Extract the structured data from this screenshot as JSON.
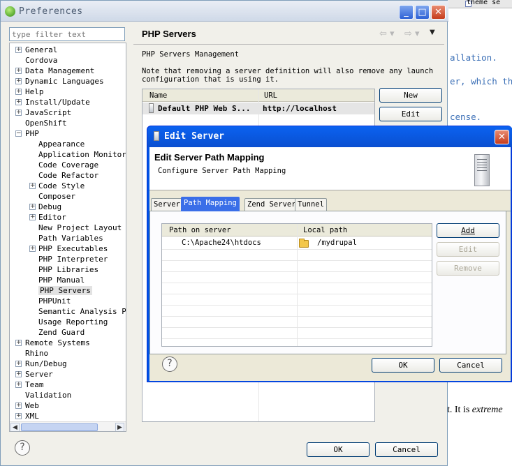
{
  "background_editor": {
    "tab_label": "theme se",
    "line1": "allation.",
    "line2": "er, which th",
    "line3": "cense.",
    "line4_prefix": "t. It is ",
    "line4_em": "extreme"
  },
  "preferences": {
    "title": "Preferences",
    "filter_placeholder": "type filter text",
    "tree": [
      {
        "label": "General",
        "expandable": true,
        "depth": 0
      },
      {
        "label": "Cordova",
        "expandable": false,
        "depth": 0
      },
      {
        "label": "Data Management",
        "expandable": true,
        "depth": 0
      },
      {
        "label": "Dynamic Languages",
        "expandable": true,
        "depth": 0
      },
      {
        "label": "Help",
        "expandable": true,
        "depth": 0
      },
      {
        "label": "Install/Update",
        "expandable": true,
        "depth": 0
      },
      {
        "label": "JavaScript",
        "expandable": true,
        "depth": 0
      },
      {
        "label": "OpenShift",
        "expandable": false,
        "depth": 0
      },
      {
        "label": "PHP",
        "expandable": true,
        "expanded": true,
        "depth": 0
      },
      {
        "label": "Appearance",
        "expandable": false,
        "depth": 1
      },
      {
        "label": "Application Monitorin",
        "expandable": false,
        "depth": 1
      },
      {
        "label": "Code Coverage",
        "expandable": false,
        "depth": 1
      },
      {
        "label": "Code Refactor",
        "expandable": false,
        "depth": 1
      },
      {
        "label": "Code Style",
        "expandable": true,
        "depth": 1
      },
      {
        "label": "Composer",
        "expandable": false,
        "depth": 1
      },
      {
        "label": "Debug",
        "expandable": true,
        "depth": 1
      },
      {
        "label": "Editor",
        "expandable": true,
        "depth": 1
      },
      {
        "label": "New Project Layout",
        "expandable": false,
        "depth": 1
      },
      {
        "label": "Path Variables",
        "expandable": false,
        "depth": 1
      },
      {
        "label": "PHP Executables",
        "expandable": true,
        "depth": 1
      },
      {
        "label": "PHP Interpreter",
        "expandable": false,
        "depth": 1
      },
      {
        "label": "PHP Libraries",
        "expandable": false,
        "depth": 1
      },
      {
        "label": "PHP Manual",
        "expandable": false,
        "depth": 1
      },
      {
        "label": "PHP Servers",
        "expandable": false,
        "depth": 1,
        "selected": true
      },
      {
        "label": "PHPUnit",
        "expandable": false,
        "depth": 1
      },
      {
        "label": "Semantic Analysis Pro",
        "expandable": false,
        "depth": 1
      },
      {
        "label": "Usage Reporting",
        "expandable": false,
        "depth": 1
      },
      {
        "label": "Zend Guard",
        "expandable": false,
        "depth": 1
      },
      {
        "label": "Remote Systems",
        "expandable": true,
        "depth": 0
      },
      {
        "label": "Rhino",
        "expandable": false,
        "depth": 0
      },
      {
        "label": "Run/Debug",
        "expandable": true,
        "depth": 0
      },
      {
        "label": "Server",
        "expandable": true,
        "depth": 0
      },
      {
        "label": "Team",
        "expandable": true,
        "depth": 0
      },
      {
        "label": "Validation",
        "expandable": false,
        "depth": 0
      },
      {
        "label": "Web",
        "expandable": true,
        "depth": 0
      },
      {
        "label": "XML",
        "expandable": true,
        "depth": 0
      }
    ],
    "page_title": "PHP Servers",
    "management_label": "PHP Servers Management",
    "note_line1": "Note that removing a server definition will also remove any launch",
    "note_line2": "configuration that is using it.",
    "table": {
      "columns": [
        "Name",
        "URL"
      ],
      "rows": [
        {
          "name": "Default PHP Web S...",
          "url": "http://localhost"
        }
      ]
    },
    "buttons": {
      "new": "New",
      "edit": "Edit",
      "ok": "OK",
      "cancel": "Cancel"
    },
    "help_glyph": "?"
  },
  "edit_server": {
    "title": "Edit Server",
    "header_title": "Edit Server Path Mapping",
    "header_subtitle": "Configure Server Path Mapping",
    "tabs": [
      "Server",
      "Path Mapping",
      "Zend Server",
      "Tunnel"
    ],
    "active_tab": "Path Mapping",
    "table": {
      "columns": [
        "Path on server",
        "Local path"
      ],
      "rows": [
        {
          "server_path": "C:\\Apache24\\htdocs",
          "local_path": "/mydrupal"
        }
      ]
    },
    "buttons": {
      "add": "Add",
      "edit": "Edit",
      "remove": "Remove",
      "ok": "OK",
      "cancel": "Cancel"
    },
    "help_glyph": "?"
  }
}
